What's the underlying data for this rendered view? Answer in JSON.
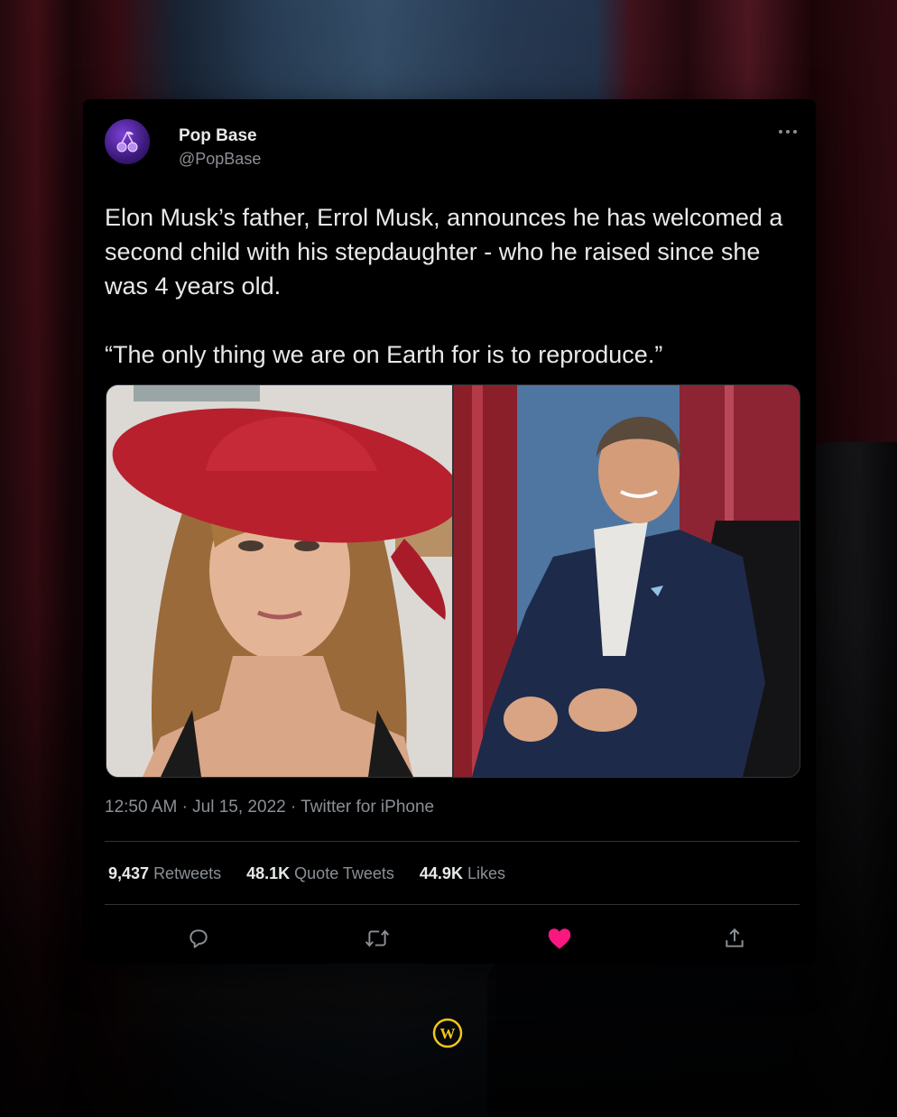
{
  "tweet": {
    "author": {
      "name": "Pop Base",
      "handle": "@PopBase",
      "avatar_icon": "cherry-icon"
    },
    "text_paragraphs": [
      "Elon Musk’s father, Errol Musk, announces he has welcomed a second child with his stepdaughter - who he raised since she was 4 years old.",
      "“The only thing we are on Earth for is to reproduce.”"
    ],
    "media": [
      {
        "description_icon": "photo-woman-red-hat"
      },
      {
        "description_icon": "photo-man-suit-chair"
      }
    ],
    "time": "12:50 AM",
    "date": "Jul 15, 2022",
    "source": "Twitter for iPhone",
    "separator": "·",
    "stats": {
      "retweets_count": "9,437",
      "retweets_label": "Retweets",
      "quotes_count": "48.1K",
      "quotes_label": "Quote Tweets",
      "likes_count": "44.9K",
      "likes_label": "Likes"
    },
    "actions": {
      "reply_icon": "reply-icon",
      "retweet_icon": "retweet-icon",
      "like_icon": "heart-icon",
      "share_icon": "share-icon",
      "like_color": "#f91880"
    },
    "more_icon": "more-icon"
  },
  "watermark": {
    "logo_letter": "W",
    "logo_color": "#f5c518"
  }
}
